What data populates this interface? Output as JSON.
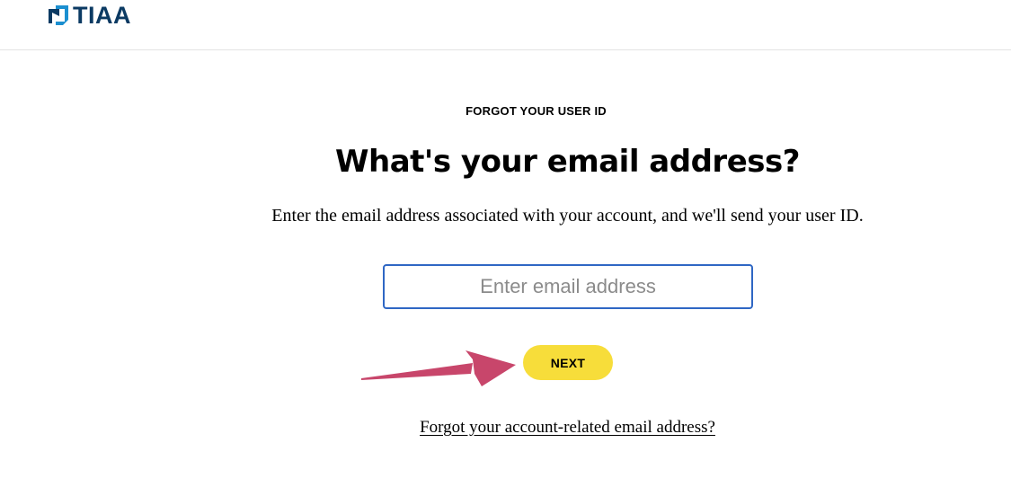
{
  "header": {
    "logo_text": "TIAA",
    "brand_color": "#0b3a63"
  },
  "main": {
    "eyebrow": "FORGOT YOUR USER ID",
    "title": "What's your email address?",
    "subtitle": "Enter the email address associated with your account, and we'll send your user ID.",
    "email_input": {
      "placeholder": "Enter email address",
      "value": ""
    },
    "next_button_label": "NEXT",
    "forgot_email_link": "Forgot your account-related email address?"
  },
  "annotation": {
    "arrow_color": "#c8466b",
    "points_to": "next-button"
  },
  "colors": {
    "button_yellow": "#f7dd3a",
    "input_border": "#2f67c4"
  }
}
